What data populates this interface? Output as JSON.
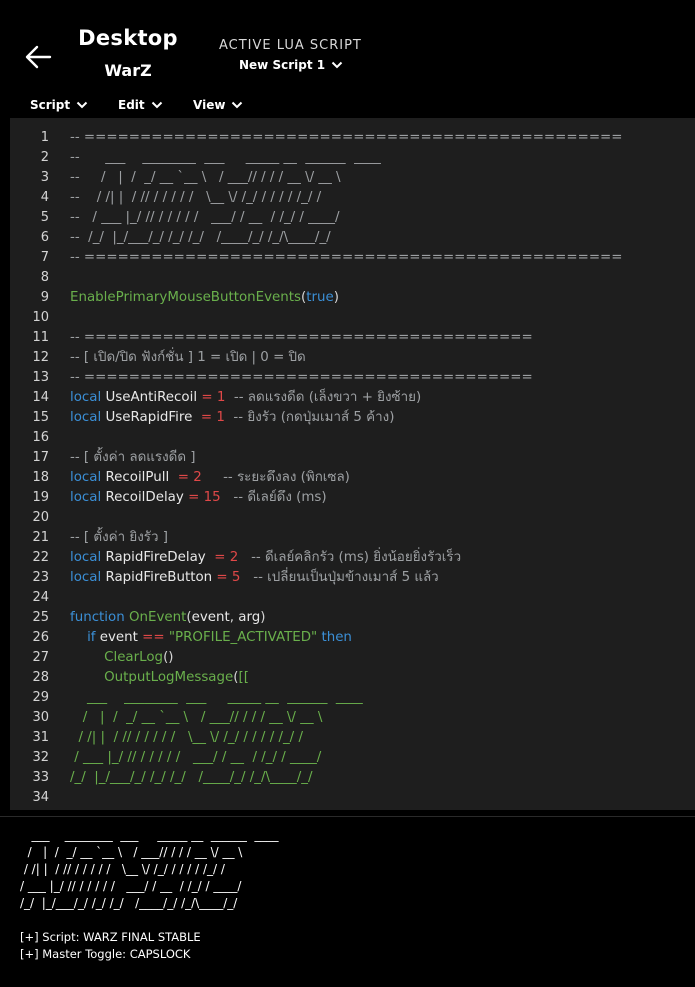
{
  "header": {
    "title": "Desktop",
    "profile": "WarZ",
    "caption": "ACTIVE LUA SCRIPT",
    "script_name": "New Script 1"
  },
  "menu": [
    {
      "label": "Script"
    },
    {
      "label": "Edit"
    },
    {
      "label": "View"
    }
  ],
  "editor": {
    "lines": [
      {
        "n": "1",
        "t": "-- ================================================"
      },
      {
        "n": "2",
        "t": "--      ___    ________  ___     _____ __  ______  ____"
      },
      {
        "n": "3",
        "t": "--     /   |  /  _/ __ `__ \\   / ___// / / / __ \\/ __ \\"
      },
      {
        "n": "4",
        "t": "--    / /| |  / // / / / / /   \\__ \\/ /_/ / / / / /_/ /"
      },
      {
        "n": "5",
        "t": "--   / ___ |_/ // / / / / /   ___/ / __  / /_/ / ____/"
      },
      {
        "n": "6",
        "t": "--  /_/  |_/___/_/ /_/ /_/   /____/_/ /_/\\____/_/"
      },
      {
        "n": "7",
        "t": "-- ================================================"
      },
      {
        "n": "8",
        "t": ""
      },
      {
        "n": "9",
        "t": "EnablePrimaryMouseButtonEvents(true)"
      },
      {
        "n": "10",
        "t": ""
      },
      {
        "n": "11",
        "t": "-- ========================================"
      },
      {
        "n": "12",
        "t": "-- [ เปิด/ปิด ฟังก์ชั่น ] 1 = เปิด | 0 = ปิด"
      },
      {
        "n": "13",
        "t": "-- ========================================"
      },
      {
        "n": "14",
        "t": "local UseAntiRecoil = 1  -- ลดแรงดีด (เล็งขวา + ยิงซ้าย)"
      },
      {
        "n": "15",
        "t": "local UseRapidFire  = 1  -- ยิงรัว (กดปุ่มเมาส์ 5 ค้าง)"
      },
      {
        "n": "16",
        "t": ""
      },
      {
        "n": "17",
        "t": "-- [ ตั้งค่า ลดแรงดีด ]"
      },
      {
        "n": "18",
        "t": "local RecoilPull  = 2     -- ระยะดึงลง (พิกเซล)"
      },
      {
        "n": "19",
        "t": "local RecoilDelay = 15   -- ดีเลย์ดึง (ms)"
      },
      {
        "n": "20",
        "t": ""
      },
      {
        "n": "21",
        "t": "-- [ ตั้งค่า ยิงรัว ]"
      },
      {
        "n": "22",
        "t": "local RapidFireDelay  = 2   -- ดีเลย์คลิกรัว (ms) ยิ่งน้อยยิ่งรัวเร็ว"
      },
      {
        "n": "23",
        "t": "local RapidFireButton = 5   -- เปลี่ยนเป็นปุ่มข้างเมาส์ 5 แล้ว"
      },
      {
        "n": "24",
        "t": ""
      },
      {
        "n": "25",
        "t": "function OnEvent(event, arg)"
      },
      {
        "n": "26",
        "t": "    if event == \"PROFILE_ACTIVATED\" then"
      },
      {
        "n": "27",
        "t": "        ClearLog()"
      },
      {
        "n": "28",
        "t": "        OutputLogMessage([["
      },
      {
        "n": "29",
        "t": "    ___    ________  ___     _____ __  ______  ____"
      },
      {
        "n": "30",
        "t": "   /   |  /  _/ __ `__ \\   / ___// / / / __ \\/ __ \\"
      },
      {
        "n": "31",
        "t": "  / /| |  / // / / / / /   \\__ \\/ /_/ / / / / /_/ /"
      },
      {
        "n": "32",
        "t": " / ___ |_/ // / / / / /   ___/ / __  / /_/ / ____/"
      },
      {
        "n": "33",
        "t": "/_/  |_/___/_/ /_/ /_/   /____/_/ /_/\\____/_/"
      },
      {
        "n": "34",
        "t": ""
      }
    ]
  },
  "output": {
    "ascii": "   ___    ________  ___     _____ __  ______  ____\n  /   |  /  _/ __ `__ \\   / ___// / / / __ \\/ __ \\\n / /| |  / // / / / / /   \\__ \\/ /_/ / / / / /_/ /\n/ ___ |_/ // / / / / /   ___/ / __  / /_/ / ____/\n/_/  |_/___/_/ /_/ /_/   /____/_/ /_/\\____/_/",
    "log": [
      "[+] Script: WARZ FINAL STABLE",
      "[+] Master Toggle: CAPSLOCK"
    ]
  },
  "colors": {
    "comment": "#9da0a3",
    "keyword": "#3b8fd6",
    "function": "#6ab04c",
    "number": "#e04848",
    "editor_bg": "#1e1e1e"
  }
}
